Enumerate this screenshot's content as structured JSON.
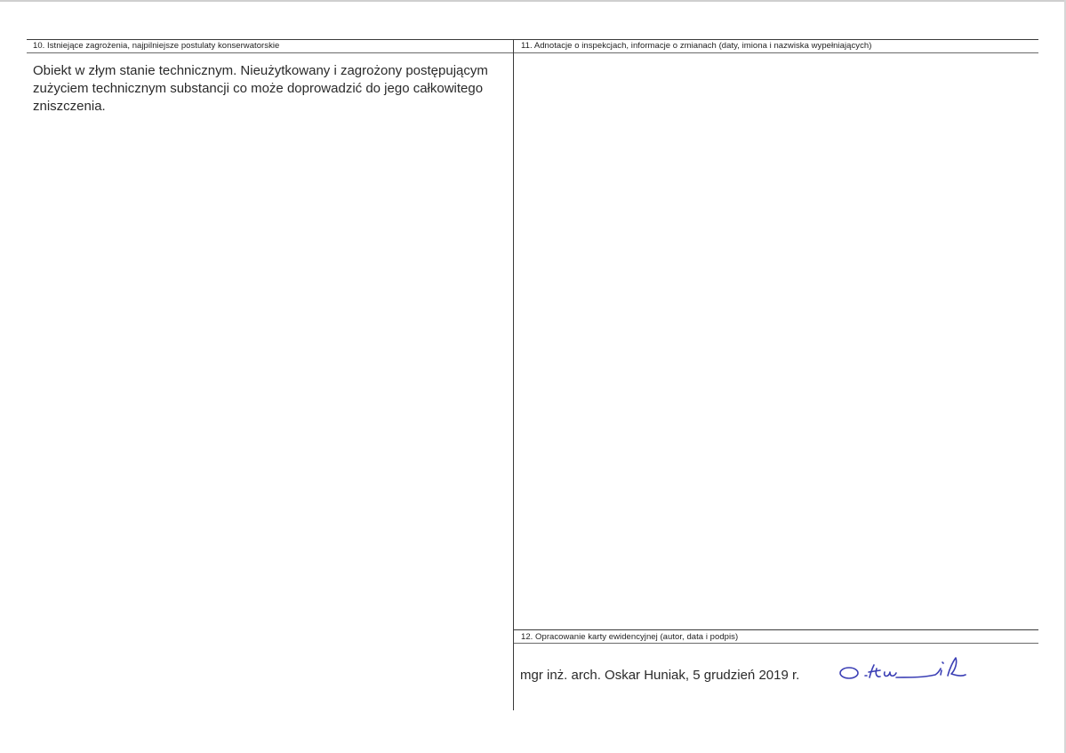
{
  "sections": {
    "threats": {
      "label": "10. Istniejące zagrożenia, najpilniejsze postulaty konserwatorskie",
      "text": "Obiekt w złym stanie technicznym. Nieużytkowany i zagrożony postępującym zużyciem technicznym substancji co może doprowadzić do jego całkowitego zniszczenia."
    },
    "annotations": {
      "label": "11. Adnotacje o inspekcjach, informacje o zmianach (daty, imiona i nazwiska wypełniających)"
    },
    "author": {
      "label": "12. Opracowanie karty ewidencyjnej (autor, data i podpis)",
      "text": "mgr inż. arch. Oskar Huniak, 5 grudzień 2019 r.",
      "signature": "O. Huniak"
    }
  },
  "colors": {
    "signature_ink": "#3b3fb5",
    "text": "#2a2a2a"
  }
}
